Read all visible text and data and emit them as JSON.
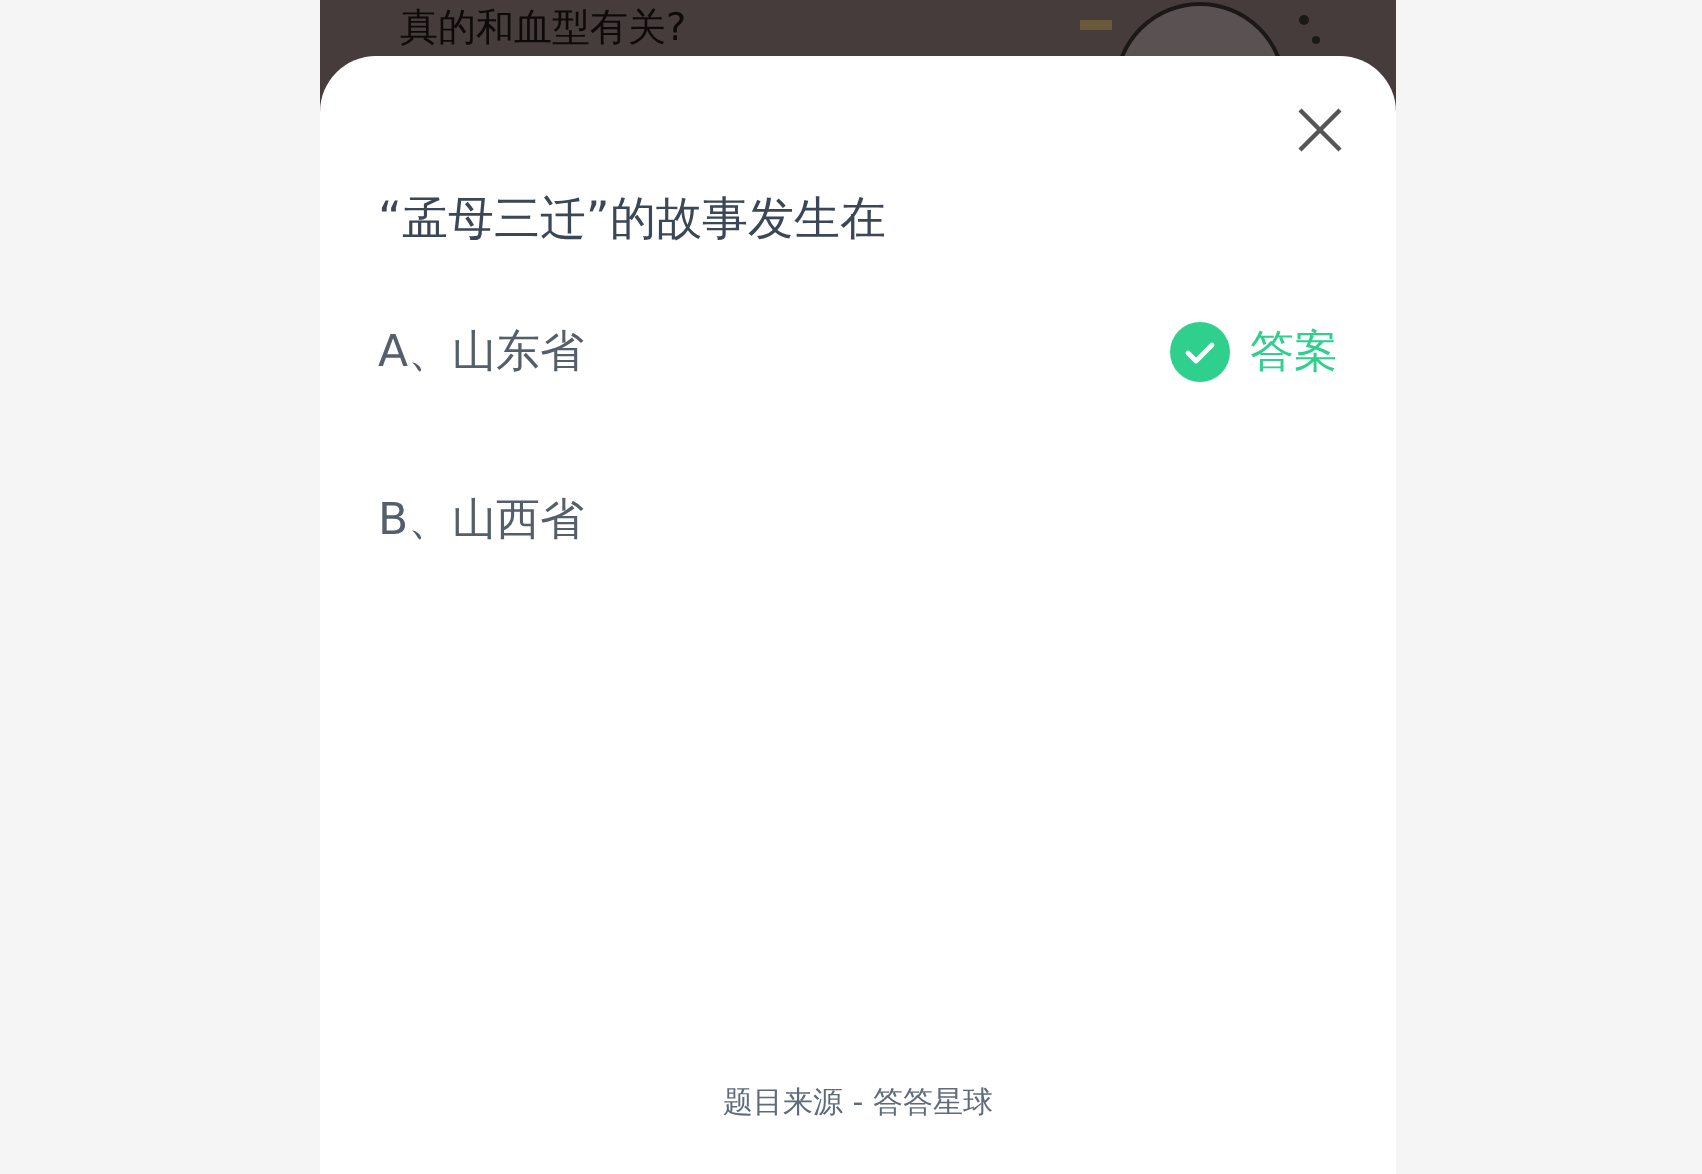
{
  "background": {
    "text": "真的和血型有关?"
  },
  "question": "“孟母三迁”的故事发生在",
  "options": [
    {
      "label": "A、山东省",
      "correct": true
    },
    {
      "label": "B、山西省",
      "correct": false
    }
  ],
  "answer_label": "答案",
  "source": "题目来源 - 答答星球"
}
